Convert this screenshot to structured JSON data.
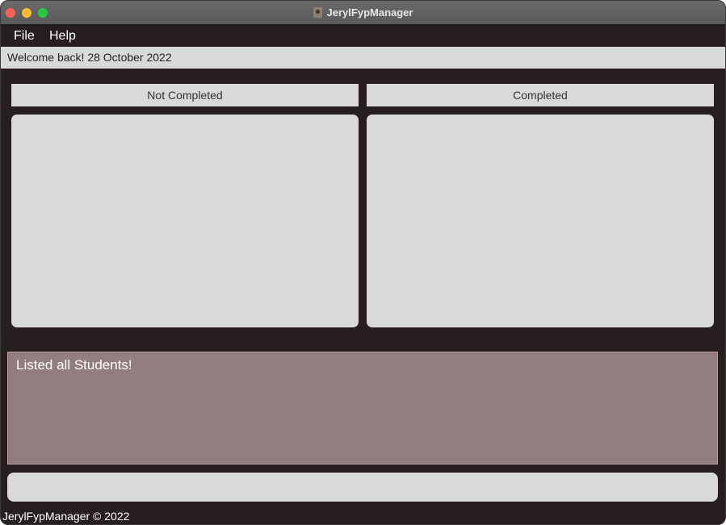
{
  "window": {
    "title": "JerylFypManager"
  },
  "menu": {
    "file": "File",
    "help": "Help"
  },
  "welcome": {
    "text": "Welcome back! 28 October 2022"
  },
  "columns": {
    "not_completed": "Not Completed",
    "completed": "Completed"
  },
  "result": {
    "text": "Listed all Students!"
  },
  "command": {
    "value": "",
    "placeholder": ""
  },
  "footer": {
    "text": "JerylFypManager © 2022"
  },
  "colors": {
    "background": "#261e1f",
    "panel": "#d9d9d9",
    "result_box": "#937d7e"
  }
}
